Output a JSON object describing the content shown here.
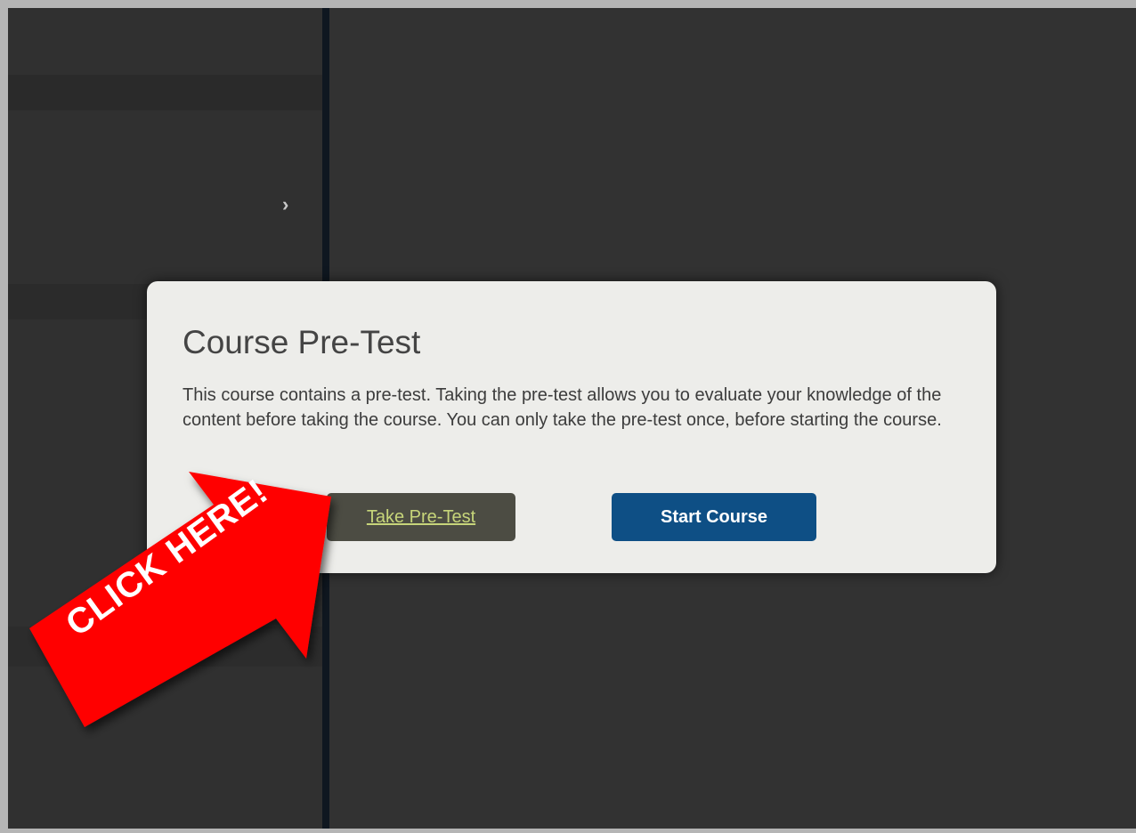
{
  "modal": {
    "title": "Course Pre-Test",
    "body": "This course contains a pre-test. Taking the pre-test allows you to evaluate your knowledge of the content before taking the course. You can only take the pre-test once, before starting the course.",
    "take_pretest_label": "Take Pre-Test",
    "start_course_label": "Start Course"
  },
  "sidebar": {
    "chevron_icon": "chevron-right-icon"
  },
  "callout": {
    "label": "CLICK HERE!",
    "color": "#ff0000"
  },
  "colors": {
    "start_button": "#0e4f85",
    "pretest_button": "#4c4c43",
    "pretest_text": "#c7d57a"
  }
}
